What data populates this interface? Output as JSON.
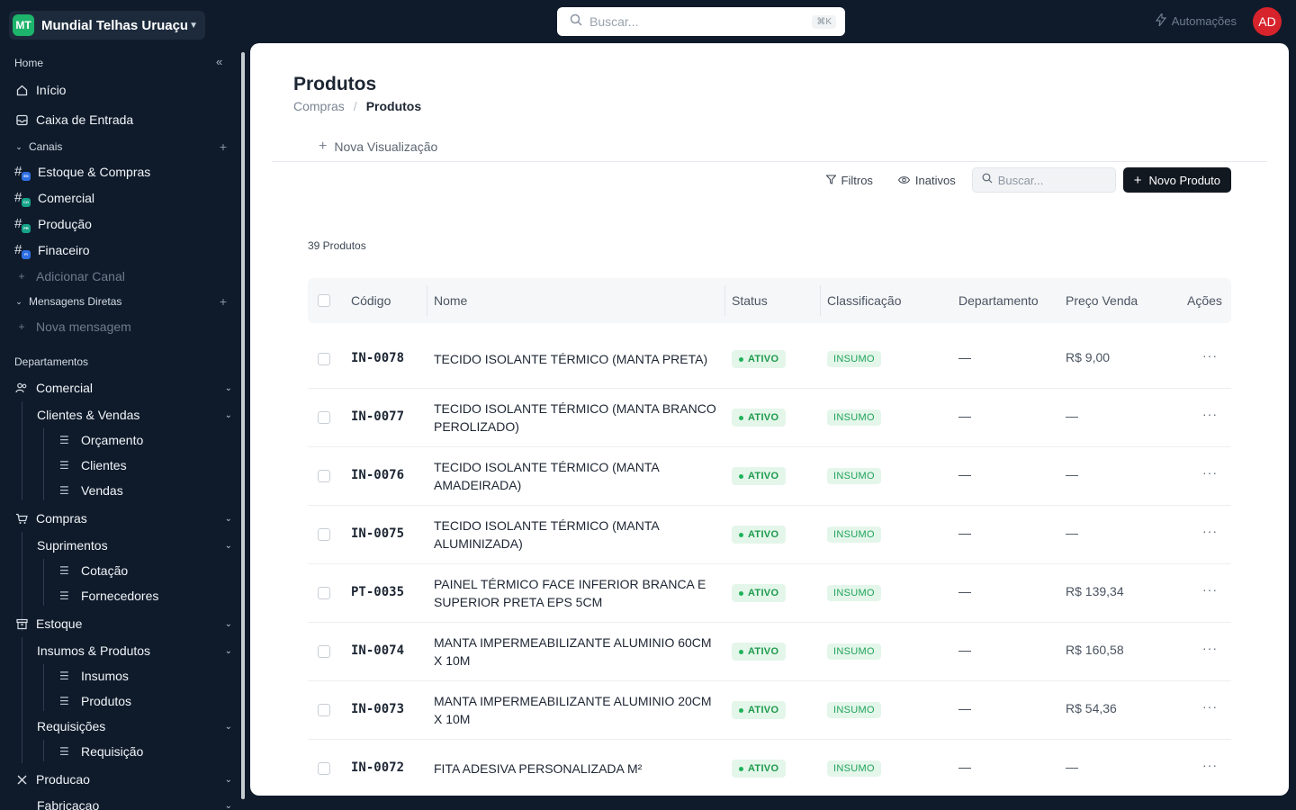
{
  "workspace": {
    "initials": "MT",
    "name": "Mundial Telhas Uruaçu"
  },
  "top_search": {
    "placeholder": "Buscar...",
    "shortcut": "⌘K"
  },
  "automations_label": "Automações",
  "user_initials": "AD",
  "sidebar": {
    "home_section": "Home",
    "inicio": "Início",
    "inbox": "Caixa de Entrada",
    "channels_section": "Canais",
    "channels": [
      {
        "label": "Estoque & Compras",
        "badge": "ES",
        "color": "#2f6fe4"
      },
      {
        "label": "Comercial",
        "badge": "CO",
        "color": "#16a38a"
      },
      {
        "label": "Produção",
        "badge": "PR",
        "color": "#16a38a"
      },
      {
        "label": "Finaceiro",
        "badge": "FI",
        "color": "#2f6fe4"
      }
    ],
    "add_channel": "Adicionar Canal",
    "dm_section": "Mensagens Diretas",
    "new_message": "Nova mensagem",
    "departments_section": "Departamentos",
    "comercial": "Comercial",
    "clientes_vendas": "Clientes & Vendas",
    "orcamento": "Orçamento",
    "clientes": "Clientes",
    "vendas": "Vendas",
    "compras": "Compras",
    "suprimentos": "Suprimentos",
    "cotacao": "Cotação",
    "fornecedores": "Fornecedores",
    "estoque": "Estoque",
    "insumos_produtos": "Insumos & Produtos",
    "insumos": "Insumos",
    "produtos": "Produtos",
    "requisicoes": "Requisições",
    "requisicao": "Requisição",
    "producao": "Producao",
    "fabricacao": "Fabricacao"
  },
  "page": {
    "title": "Produtos",
    "breadcrumb_parent": "Compras",
    "breadcrumb_current": "Produtos",
    "new_view": "Nova Visualização",
    "filters": "Filtros",
    "inactive": "Inativos",
    "search_placeholder": "Buscar...",
    "new_product": "Novo Produto",
    "count": "39 Produtos"
  },
  "table": {
    "headers": {
      "code": "Código",
      "name": "Nome",
      "status": "Status",
      "classification": "Classificação",
      "department": "Departamento",
      "price": "Preço Venda",
      "actions": "Ações"
    },
    "rows": [
      {
        "code": "IN-0078",
        "name": "TECIDO ISOLANTE TÉRMICO (MANTA PRETA)",
        "status": "ATIVO",
        "class": "INSUMO",
        "dept": "—",
        "price": "R$ 9,00"
      },
      {
        "code": "IN-0077",
        "name": "TECIDO ISOLANTE TÉRMICO (MANTA BRANCO PEROLIZADO)",
        "status": "ATIVO",
        "class": "INSUMO",
        "dept": "—",
        "price": "—"
      },
      {
        "code": "IN-0076",
        "name": "TECIDO ISOLANTE TÉRMICO (MANTA AMADEIRADA)",
        "status": "ATIVO",
        "class": "INSUMO",
        "dept": "—",
        "price": "—"
      },
      {
        "code": "IN-0075",
        "name": "TECIDO ISOLANTE TÉRMICO (MANTA ALUMINIZADA)",
        "status": "ATIVO",
        "class": "INSUMO",
        "dept": "—",
        "price": "—"
      },
      {
        "code": "PT-0035",
        "name": "PAINEL TÉRMICO FACE INFERIOR BRANCA E SUPERIOR PRETA EPS 5CM",
        "status": "ATIVO",
        "class": "INSUMO",
        "dept": "—",
        "price": "R$ 139,34"
      },
      {
        "code": "IN-0074",
        "name": "MANTA IMPERMEABILIZANTE ALUMINIO 60CM X 10M",
        "status": "ATIVO",
        "class": "INSUMO",
        "dept": "—",
        "price": "R$ 160,58"
      },
      {
        "code": "IN-0073",
        "name": "MANTA IMPERMEABILIZANTE ALUMINIO 20CM X 10M",
        "status": "ATIVO",
        "class": "INSUMO",
        "dept": "—",
        "price": "R$ 54,36"
      },
      {
        "code": "IN-0072",
        "name": "FITA ADESIVA PERSONALIZADA M²",
        "status": "ATIVO",
        "class": "INSUMO",
        "dept": "—",
        "price": "—"
      }
    ]
  },
  "icons": {
    "collapse": "double-chevron-left-icon",
    "home": "home-icon",
    "inbox": "inbox-icon",
    "channel": "hash-icon",
    "list": "list-icon",
    "more": "more-horizontal-icon"
  }
}
